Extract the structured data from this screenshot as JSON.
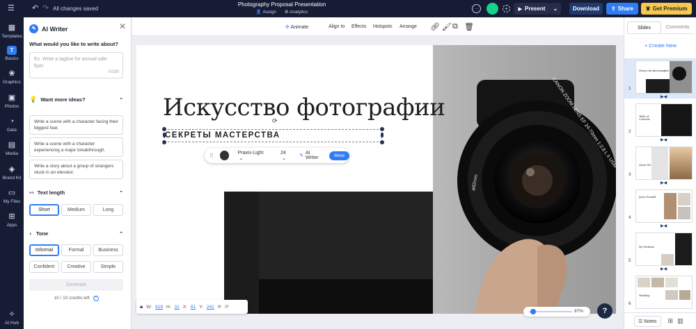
{
  "topbar": {
    "saved": "All changes saved",
    "doc_title": "Photography Proposal Presentation",
    "assign": "Assign",
    "analytics": "Analytics",
    "present": "Present",
    "download": "Download",
    "share": "Share",
    "premium": "Get Premium",
    "colors": {
      "bg": "#171c35",
      "download": "#1e3a6e",
      "share": "#2f7cf6",
      "premium": "#f7c948",
      "avatar": "#14d38a"
    }
  },
  "rail": {
    "items": [
      {
        "label": "Templates",
        "icon": "templates-icon"
      },
      {
        "label": "Basics",
        "icon": "text-icon",
        "glyph": "T"
      },
      {
        "label": "Graphics",
        "icon": "graphics-icon"
      },
      {
        "label": "Photos",
        "icon": "photos-icon"
      },
      {
        "label": "Data",
        "icon": "data-icon"
      },
      {
        "label": "Media",
        "icon": "media-icon"
      },
      {
        "label": "Brand Kit",
        "icon": "brand-kit-icon"
      },
      {
        "label": "My Files",
        "icon": "folder-icon"
      },
      {
        "label": "Apps",
        "icon": "apps-icon"
      },
      {
        "label": "AI Hub",
        "icon": "ai-hub-icon"
      }
    ]
  },
  "ai_writer": {
    "title": "AI Writer",
    "prompt_label": "What would you like to write about?",
    "placeholder": "Ex. Write a tagline for annual sale flyer.",
    "counter": "0/150",
    "ideas_label": "Want more ideas?",
    "ideas": [
      "Write a scene with a character facing their biggest fear.",
      "Write a scene with a character experiencing a major breakthrough.",
      "Write a story about a group of strangers stuck in an elevator."
    ],
    "length_label": "Text length",
    "length_options": [
      "Short",
      "Medium",
      "Long"
    ],
    "tone_label": "Tone",
    "tone_options": [
      "Informal",
      "Formal",
      "Business",
      "Confident",
      "Creative",
      "Simple"
    ],
    "generate": "Generate",
    "credits": "10 / 10 credits left"
  },
  "toolbar": {
    "animate": "Animate",
    "align": "Align to",
    "effects": "Effects",
    "hotspots": "Hotspots",
    "arrange": "Arrange"
  },
  "slide": {
    "title": "Искусство фотографии",
    "subtitle": "СЕКРЕТЫ МАСТЕРСТВА",
    "lens_text": "CANON ZOOM LENS EF 24-70mm 1:2.8 L II USM",
    "lens_mm": "ø82mm"
  },
  "textbar": {
    "font": "Praxis-Light",
    "size": "24",
    "ai": "AI Writer",
    "more": "More"
  },
  "position": {
    "w_label": "W:",
    "w": "618",
    "h_label": "H:",
    "h": "31",
    "x_label": "X:",
    "x": "81",
    "y_label": "Y:",
    "y": "241",
    "rot": "0°"
  },
  "zoom": "97%",
  "slides_panel": {
    "tab_slides": "Slides",
    "tab_comments": "Comments",
    "create": "+ Create New",
    "thumbs": [
      {
        "num": "1",
        "caption": "Искусство фотографии"
      },
      {
        "num": "2",
        "caption": "Table of Contents"
      },
      {
        "num": "3",
        "caption": "About Me"
      },
      {
        "num": "4",
        "caption": "Jason Doodall"
      },
      {
        "num": "5",
        "caption": "My Portfolio"
      },
      {
        "num": "6",
        "caption": "Wedding"
      }
    ],
    "notes": "Notes"
  },
  "help": "?"
}
